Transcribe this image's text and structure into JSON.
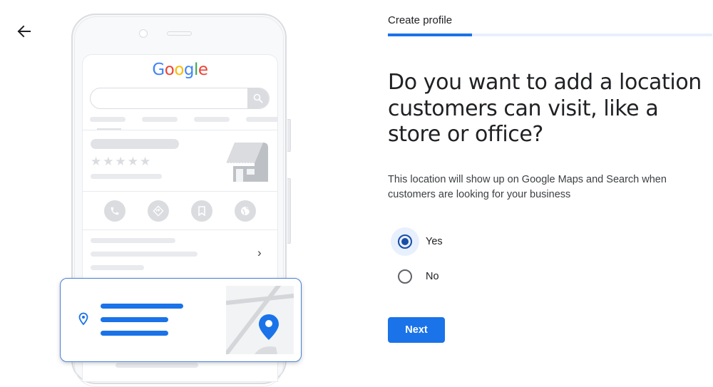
{
  "header": {
    "back_icon": "arrow-left-icon",
    "step_title": "Create profile",
    "progress_percent": 26
  },
  "illustration": {
    "search_logo": "Google",
    "logo_colors": [
      "#4285f4",
      "#ea4335",
      "#fbbc05",
      "#4285f4",
      "#34a853",
      "#ea4335"
    ],
    "rating_stars": 5,
    "action_icons": [
      "phone-icon",
      "directions-icon",
      "bookmark-icon",
      "globe-icon"
    ],
    "chevron": "›",
    "card_icons": [
      "location-pin-icon",
      "map-pin-icon"
    ]
  },
  "form": {
    "question": "Do you want to add a location customers can visit, like a store or office?",
    "description": "This location will show up on Google Maps and Search when customers are looking for your business",
    "options": [
      {
        "label": "Yes",
        "selected": true
      },
      {
        "label": "No",
        "selected": false
      }
    ],
    "next_label": "Next"
  },
  "colors": {
    "accent": "#1a73e8",
    "radio_selected": "#174ea6",
    "progress_track": "#e8f0fe"
  }
}
